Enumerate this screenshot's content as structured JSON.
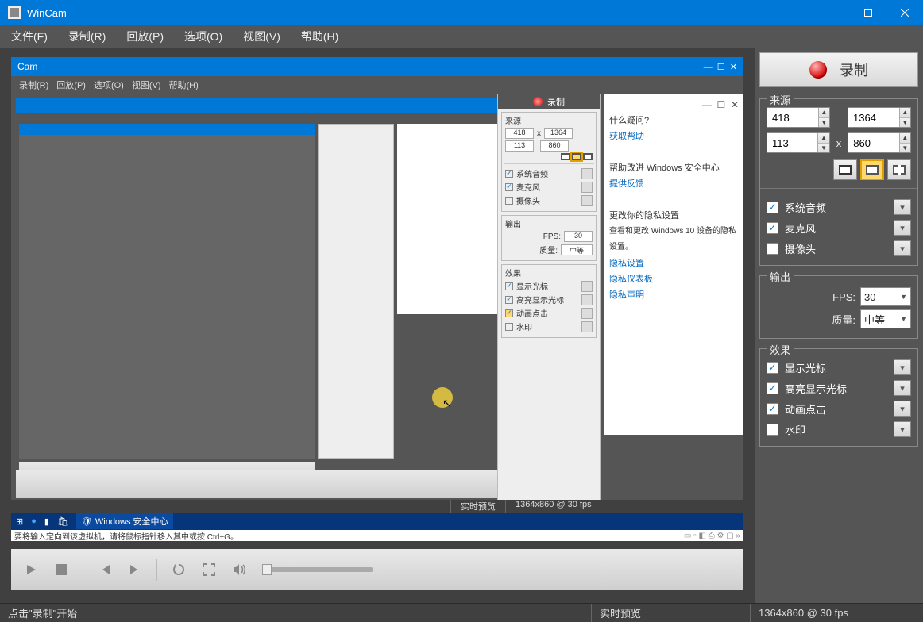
{
  "app": {
    "title": "WinCam"
  },
  "window_controls": {
    "min": "—",
    "max": "☐",
    "close": "✕"
  },
  "menu": {
    "file": "文件(F)",
    "record": "录制(R)",
    "playback": "回放(P)",
    "options": "选项(O)",
    "view": "视图(V)",
    "help": "帮助(H)"
  },
  "panel": {
    "record_button": "录制",
    "source": {
      "legend": "来源",
      "width": "418",
      "height": "113",
      "out_w": "1364",
      "out_h": "860",
      "x": "x",
      "system_audio": "系统音频",
      "microphone": "麦克风",
      "camera": "摄像头"
    },
    "output": {
      "legend": "输出",
      "fps_label": "FPS:",
      "fps_value": "30",
      "quality_label": "质量:",
      "quality_value": "中等"
    },
    "effects": {
      "legend": "效果",
      "show_cursor": "显示光标",
      "highlight_cursor": "高亮显示光标",
      "animate_click": "动画点击",
      "watermark": "水印"
    }
  },
  "preview": {
    "inner_title": "Cam",
    "inner_menu": {
      "record": "录制(R)",
      "playback": "回放(P)",
      "options": "选项(O)",
      "view": "视图(V)",
      "help": "帮助(H)"
    },
    "sp": {
      "rec": "录制",
      "src": "来源",
      "w": "418",
      "h": "113",
      "ow": "1364",
      "oh": "860",
      "sa": "系统音频",
      "mic": "麦克风",
      "cam": "摄像头",
      "out": "输出",
      "fps": "FPS:",
      "fpsv": "30",
      "ql": "质量:",
      "qlv": "中等",
      "fx": "效果",
      "c1": "显示光标",
      "c2": "高亮显示光标",
      "c3": "动画点击",
      "c4": "水印"
    },
    "help": {
      "q": "什么疑问?",
      "l1": "获取帮助",
      "h1": "帮助改进 Windows 安全中心",
      "l2": "提供反馈",
      "h2": "更改你的隐私设置",
      "h3": "查看和更改 Windows 10 设备的隐私设置。",
      "l3": "隐私设置",
      "l4": "隐私仪表板",
      "l5": "隐私声明"
    },
    "taskbar_label": "Windows 安全中心",
    "tip": "要将输入定向到该虚拟机，请将鼠标指针移入其中或按 Ctrl+G。",
    "status_mid": "实时预览",
    "status_right": "1364x860 @ 30 fps"
  },
  "status": {
    "left": "点击\"录制\"开始",
    "mid": "实时预览",
    "right": "1364x860 @ 30 fps"
  }
}
